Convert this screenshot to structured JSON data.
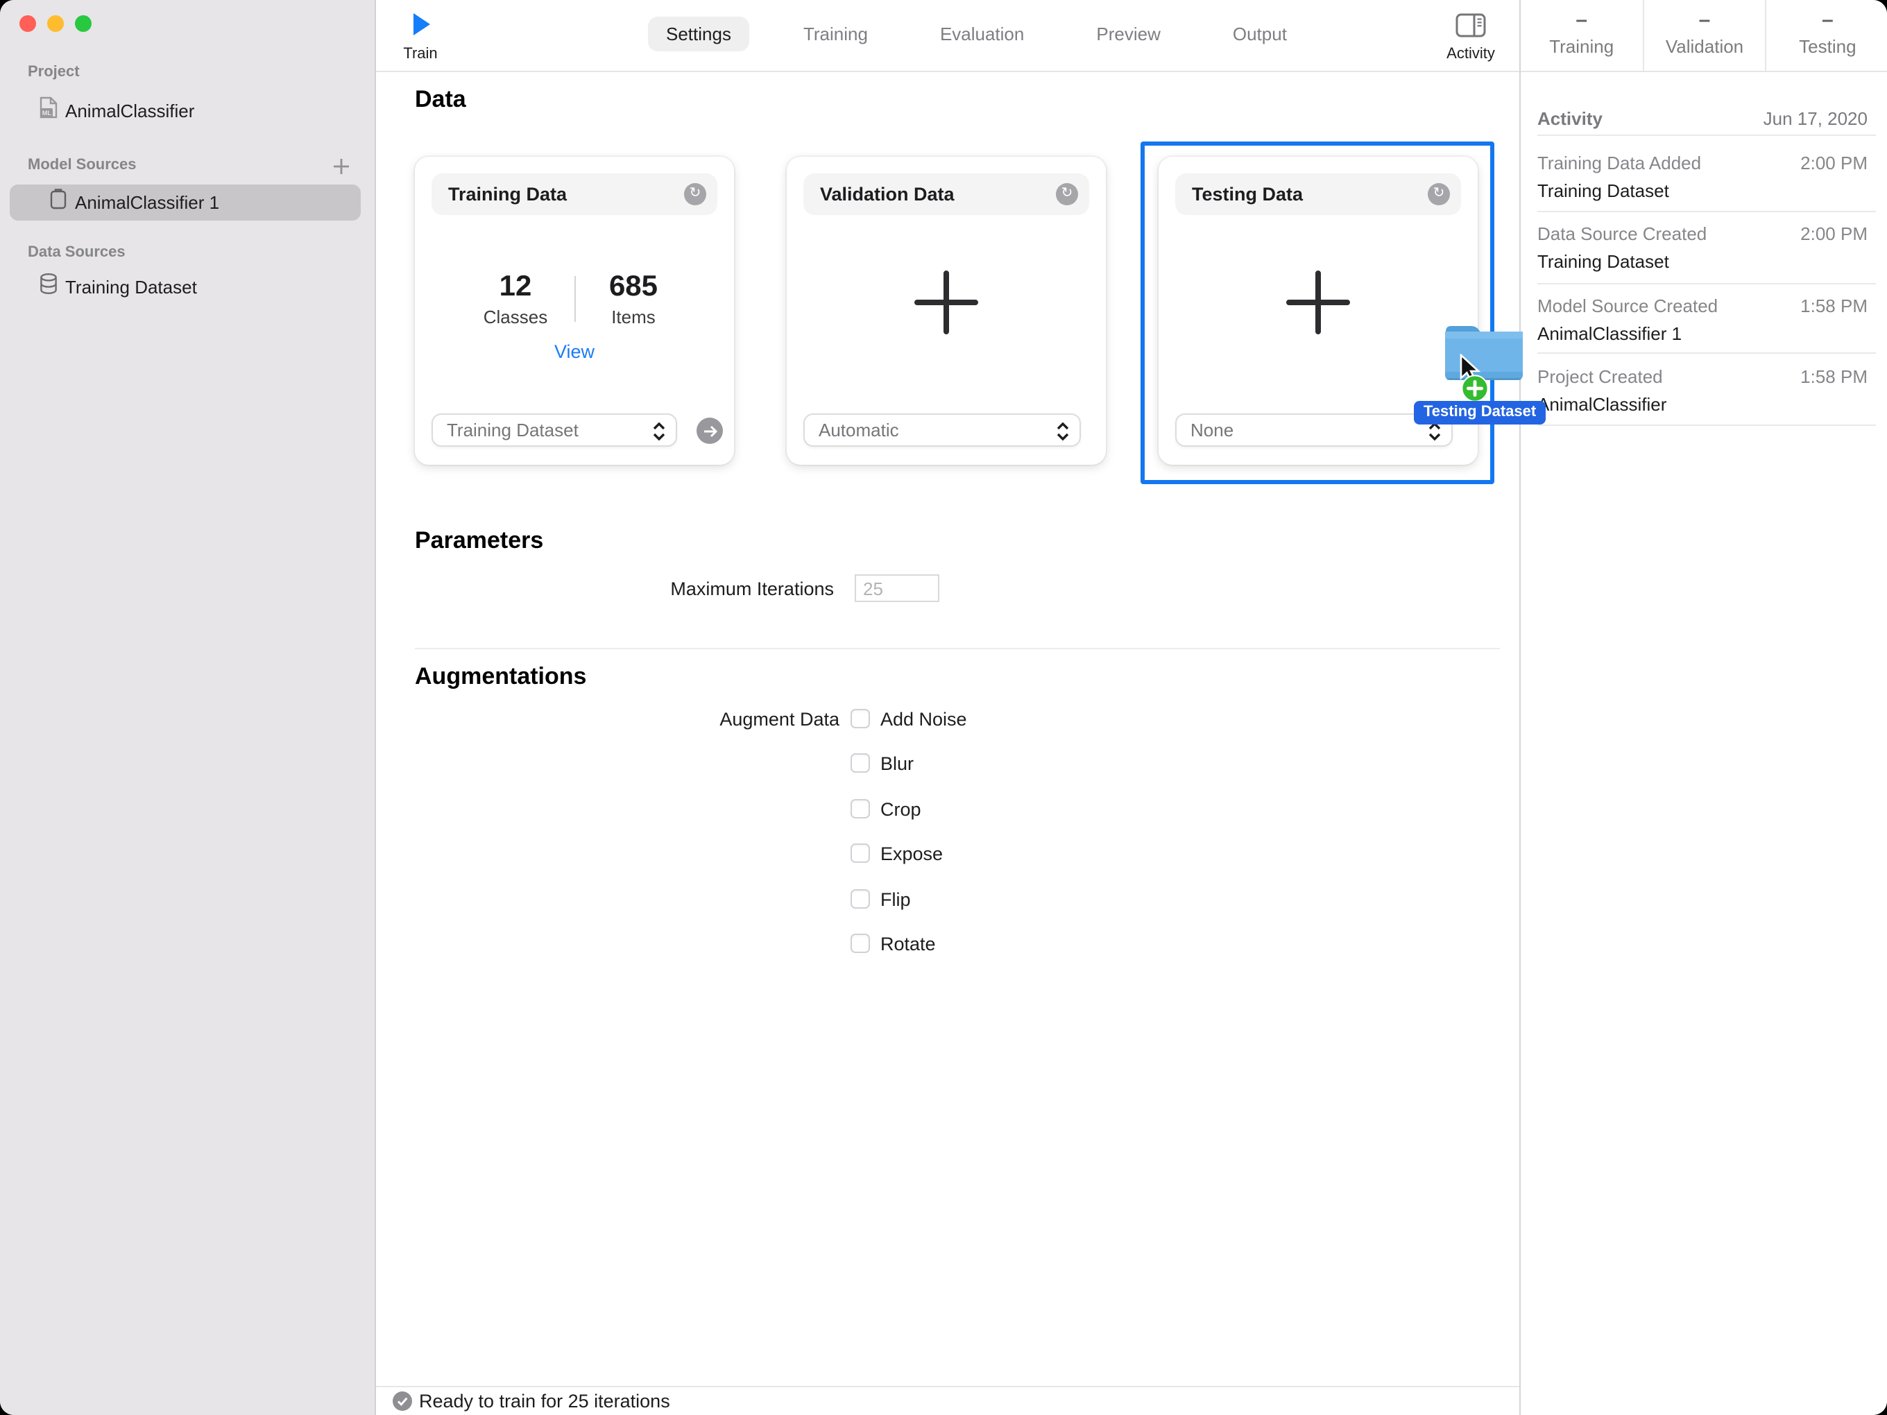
{
  "sidebar": {
    "project_label": "Project",
    "project_name": "AnimalClassifier",
    "model_sources_label": "Model Sources",
    "model_source_name": "AnimalClassifier 1",
    "data_sources_label": "Data Sources",
    "data_source_name": "Training Dataset"
  },
  "toolbar": {
    "train_label": "Train",
    "tabs": [
      "Settings",
      "Training",
      "Evaluation",
      "Preview",
      "Output"
    ],
    "active_tab": "Settings",
    "activity_label": "Activity"
  },
  "stats_header": {
    "columns": [
      {
        "value": "–",
        "label": "Training"
      },
      {
        "value": "–",
        "label": "Validation"
      },
      {
        "value": "–",
        "label": "Testing"
      }
    ]
  },
  "data_section": {
    "heading": "Data",
    "cards": [
      {
        "title": "Training Data",
        "classes_value": "12",
        "classes_label": "Classes",
        "items_value": "685",
        "items_label": "Items",
        "view_label": "View",
        "source": "Training Dataset"
      },
      {
        "title": "Validation Data",
        "source": "Automatic"
      },
      {
        "title": "Testing Data",
        "source": "None"
      }
    ]
  },
  "parameters": {
    "heading": "Parameters",
    "max_iterations_label": "Maximum Iterations",
    "max_iterations_value": "25"
  },
  "augmentations": {
    "heading": "Augmentations",
    "augment_data_label": "Augment Data",
    "options": [
      "Add Noise",
      "Blur",
      "Crop",
      "Expose",
      "Flip",
      "Rotate"
    ]
  },
  "status_bar": {
    "message": "Ready to train for 25 iterations"
  },
  "drag": {
    "tooltip_label": "Testing Dataset"
  },
  "activity_panel": {
    "heading": "Activity",
    "date": "Jun 17, 2020",
    "entries": [
      {
        "title": "Training Data Added",
        "time": "2:00 PM",
        "subtitle": "Training Dataset"
      },
      {
        "title": "Data Source Created",
        "time": "2:00 PM",
        "subtitle": "Training Dataset"
      },
      {
        "title": "Model Source Created",
        "time": "1:58 PM",
        "subtitle": "AnimalClassifier 1"
      },
      {
        "title": "Project Created",
        "time": "1:58 PM",
        "subtitle": "AnimalClassifier"
      }
    ]
  },
  "colors": {
    "accent_blue": "#1477F0",
    "link_blue": "#1B7CF5",
    "tooltip_blue": "#2364E2",
    "folder_blue": "#6FB5E9",
    "drag_badge_green": "#35BB2F",
    "sidebar_bg": "#E7E5E7",
    "selected_row": "#C8C6C8"
  }
}
